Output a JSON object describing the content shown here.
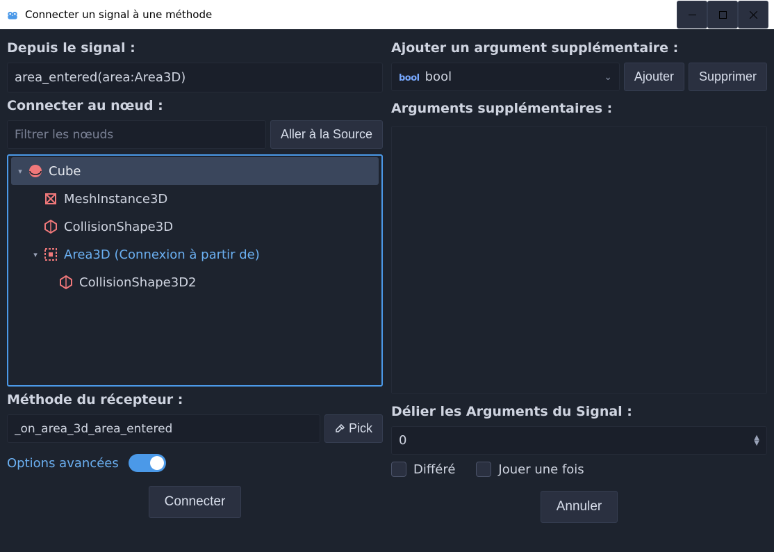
{
  "window": {
    "title": "Connecter un signal à une méthode"
  },
  "left": {
    "from_signal_label": "Depuis le signal :",
    "from_signal_value": "area_entered(area:Area3D)",
    "connect_to_label": "Connecter au nœud :",
    "filter_placeholder": "Filtrer les nœuds",
    "go_to_source": "Aller à la Source",
    "tree": [
      {
        "name": "Cube",
        "depth": 0,
        "expanded": true,
        "selected": true,
        "icon": "sphere"
      },
      {
        "name": "MeshInstance3D",
        "depth": 1,
        "icon": "mesh"
      },
      {
        "name": "CollisionShape3D",
        "depth": 1,
        "icon": "collshape"
      },
      {
        "name": "Area3D (Connexion à partir de)",
        "depth": 1,
        "expanded": true,
        "hl": true,
        "icon": "area"
      },
      {
        "name": "CollisionShape3D2",
        "depth": 2,
        "icon": "collshape"
      }
    ],
    "receiver_label": "Méthode du récepteur :",
    "receiver_value": "_on_area_3d_area_entered",
    "pick": "Pick",
    "advanced": "Options avancées",
    "connect": "Connecter"
  },
  "right": {
    "add_arg_label": "Ajouter un argument supplémentaire :",
    "type_value": "bool",
    "add": "Ajouter",
    "remove": "Supprimer",
    "extra_args_label": "Arguments supplémentaires :",
    "unbind_label": "Délier les Arguments du Signal :",
    "unbind_value": "0",
    "deferred": "Différé",
    "one_shot": "Jouer une fois",
    "cancel": "Annuler"
  }
}
